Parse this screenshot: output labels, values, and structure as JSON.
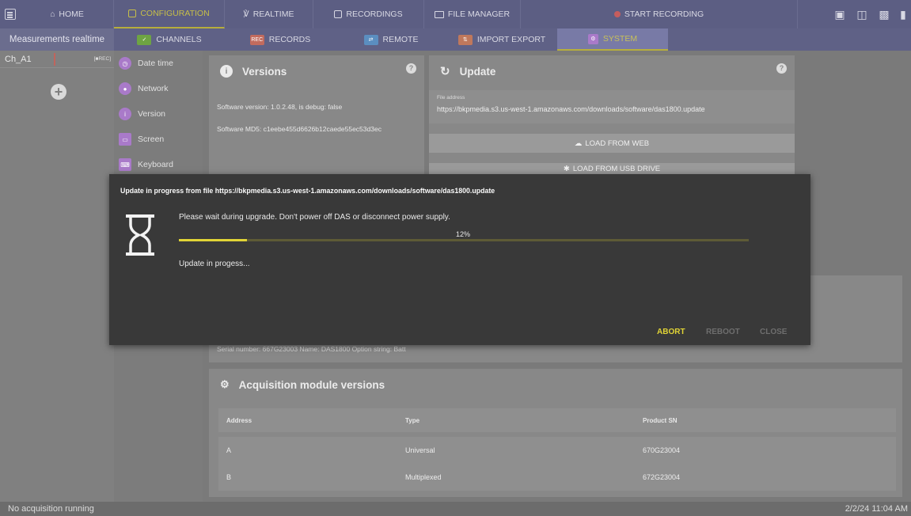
{
  "topnav": {
    "home": "HOME",
    "configuration": "CONFIGURATION",
    "realtime": "REALTIME",
    "recordings": "RECORDINGS",
    "file_manager": "FILE MANAGER",
    "start_recording": "START RECORDING"
  },
  "subnav": {
    "left_label": "Measurements realtime",
    "channels": "CHANNELS",
    "records": "RECORDS",
    "remote": "REMOTE",
    "import_export": "IMPORT EXPORT",
    "system": "SYSTEM",
    "rec_chip": "REC"
  },
  "channels": [
    {
      "name": "Ch_A1",
      "tag": "[■REC]"
    }
  ],
  "settings_menu": [
    {
      "label": "Date time",
      "icon": "clock-icon"
    },
    {
      "label": "Network",
      "icon": "network-icon"
    },
    {
      "label": "Version",
      "icon": "info-icon"
    },
    {
      "label": "Screen",
      "icon": "monitor-icon"
    },
    {
      "label": "Keyboard",
      "icon": "keyboard-icon"
    }
  ],
  "versions_card": {
    "title": "Versions",
    "software_version": "Software version: 1.0.2.48, is debug: false",
    "software_md5": "Software MD5: c1eebe455d6626b12caede55ec53d3ec"
  },
  "update_card": {
    "title": "Update",
    "file_address_label": "File address",
    "file_address": "https://bkpmedia.s3.us-west-1.amazonaws.com/downloads/software/das1800.update",
    "load_web": "LOAD FROM WEB",
    "load_usb": "LOAD FROM USB DRIVE"
  },
  "device_card": {
    "info": "Serial number: 667G23003  Name: DAS1800  Option string: Batt"
  },
  "acq_card": {
    "title": "Acquisition module versions",
    "headers": [
      "Address",
      "Type",
      "Product SN"
    ],
    "rows": [
      [
        "A",
        "Universal",
        "670G23004"
      ],
      [
        "B",
        "Multiplexed",
        "672G23004"
      ]
    ]
  },
  "modal": {
    "title": "Update in progress from file https://bkpmedia.s3.us-west-1.amazonaws.com/downloads/software/das1800.update",
    "message": "Please wait during upgrade. Don't power off DAS or disconnect power supply.",
    "progress_text": "12%",
    "progress_fraction": 0.12,
    "status": "Update in progess...",
    "abort": "ABORT",
    "reboot": "REBOOT",
    "close": "CLOSE"
  },
  "status": {
    "left": "No acquisition running",
    "right": "2/2/24 11:04 AM"
  },
  "colors": {
    "accent": "#e1d436",
    "record": "#c65d5d",
    "menu_icon": "#a97ac9"
  }
}
